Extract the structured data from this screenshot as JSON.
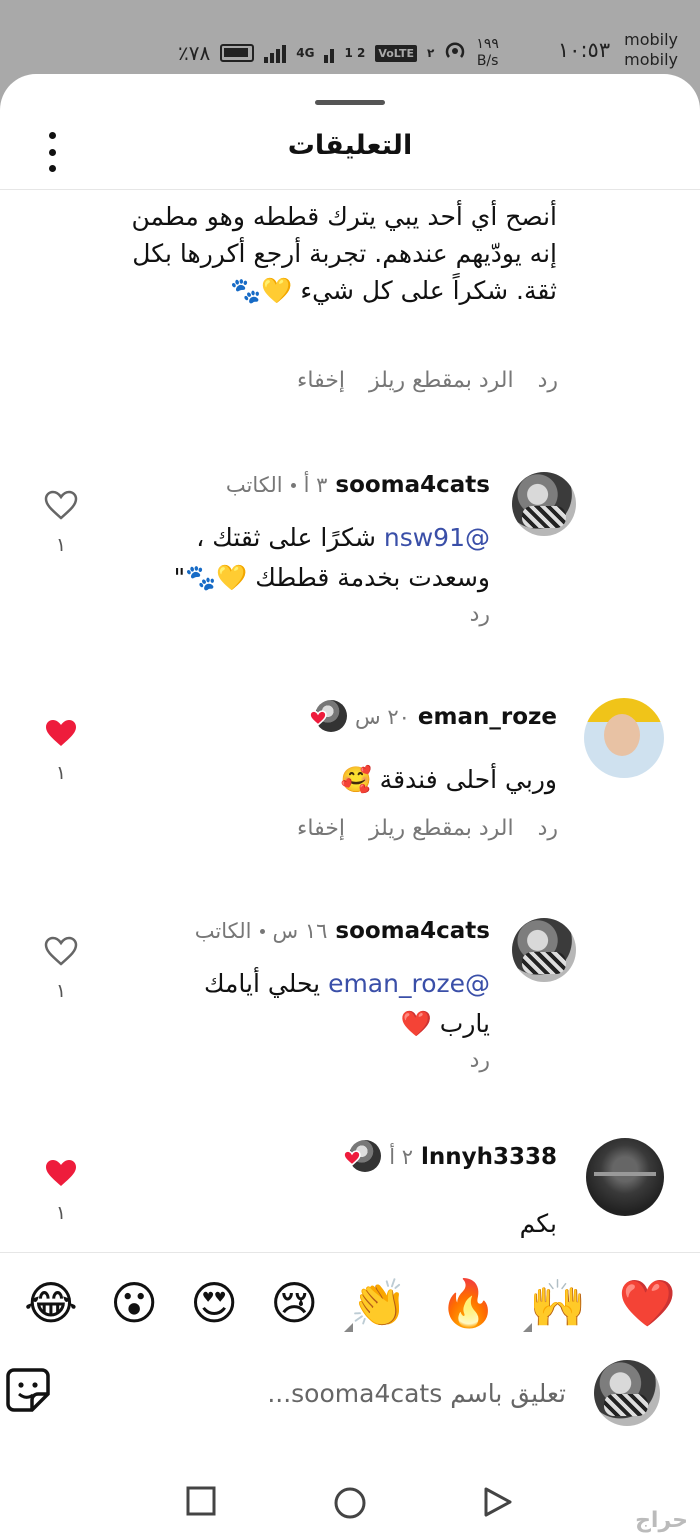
{
  "status_bar": {
    "battery": "٪٧٨",
    "network": "4G",
    "sim_slots": "1 2",
    "volte": "VoLTE",
    "volte_slot": "٢",
    "speed_value": "١٩٩",
    "speed_unit": "B/s",
    "time": "١٠:٥٣",
    "carrier_1": "mobily",
    "carrier_2": "mobily"
  },
  "header": {
    "title": "التعليقات",
    "menu_icon": "more-vertical-icon"
  },
  "comments": [
    {
      "text": "أنصح أي أحد يبي يترك قططه وهو مطمن إنه يودّيهم عندهم. تجربة أرجع أكررها بكل ثقة. شكراً على كل شيء 💛🐾",
      "actions": {
        "reply": "رد",
        "reply_reel": "الرد بمقطع ريلز",
        "hide": "إخفاء"
      }
    },
    {
      "username": "sooma4cats",
      "time": "٣ أ",
      "author_label": "الكاتب",
      "mention": "nsw91",
      "text": "شكرًا على ثقتك ، وسعدت بخدمة قططك 💛🐾\"",
      "reply": "رد",
      "liked": false,
      "like_count": "١"
    },
    {
      "username": "eman_roze",
      "time": "٢٠ س",
      "text": "وربي أحلى فندقة 🥰",
      "actions": {
        "reply": "رد",
        "reply_reel": "الرد بمقطع ريلز",
        "hide": "إخفاء"
      },
      "liked": true,
      "like_count": "١"
    },
    {
      "username": "sooma4cats",
      "time": "١٦ س",
      "author_label": "الكاتب",
      "mention": "eman_roze",
      "text": "يحلي أيامك يارب ❤️",
      "reply": "رد",
      "liked": false,
      "like_count": "١"
    },
    {
      "username": "lnnyh3338",
      "time": "٢ أ",
      "text": "بكم",
      "liked": true,
      "like_count": "١"
    }
  ],
  "emoji_bar": [
    "❤️",
    "🙌",
    "🔥",
    "👏",
    "😢",
    "😍",
    "😮",
    "😂"
  ],
  "composer": {
    "placeholder": "تعليق باسم sooma4cats...",
    "sticker_icon": "sticker-icon"
  },
  "watermark": "حراج",
  "colors": {
    "like_red": "#ee1c3c",
    "mention_blue": "#3a4fa8",
    "muted_gray": "#777777"
  }
}
